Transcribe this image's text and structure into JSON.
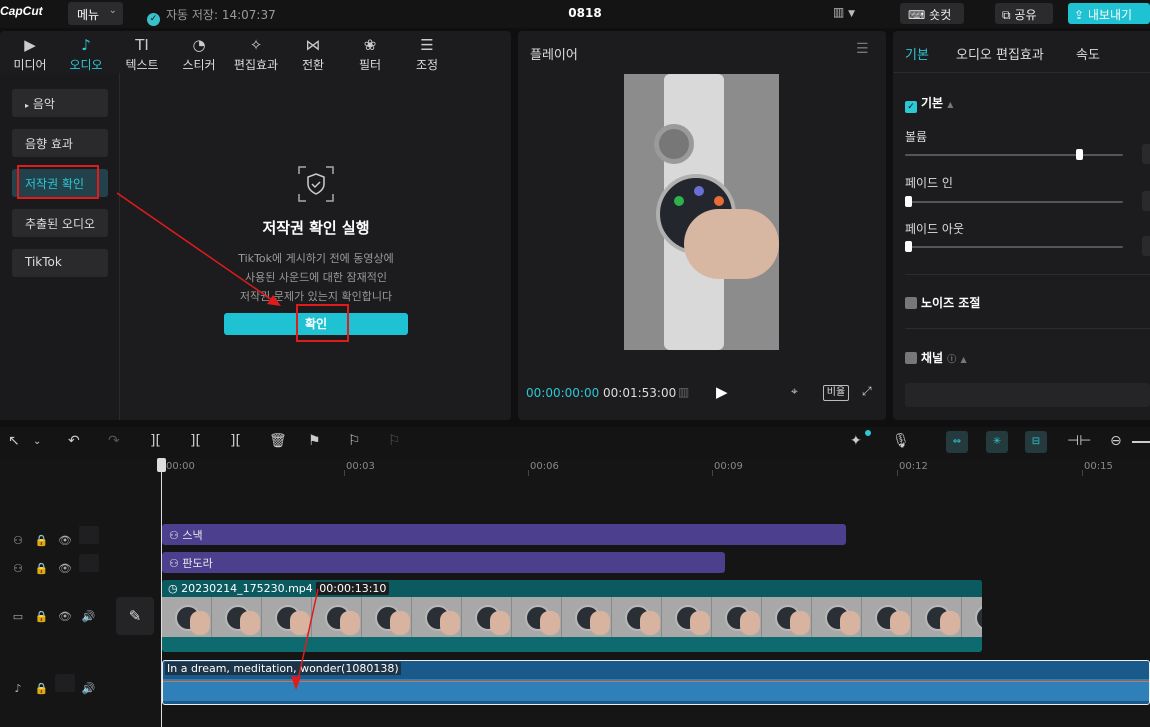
{
  "topbar": {
    "logo": "CapCut",
    "menu_label": "메뉴",
    "autosave": "자동 저장: 14:07:37",
    "project_name": "0818",
    "shortcut_label": "숏컷",
    "share_label": "공유",
    "export_label": "내보내기"
  },
  "left_panel": {
    "tabs": [
      {
        "label": "미디어",
        "icon": "media-icon"
      },
      {
        "label": "오디오",
        "icon": "audio-icon"
      },
      {
        "label": "텍스트",
        "icon": "text-icon"
      },
      {
        "label": "스티커",
        "icon": "sticker-icon"
      },
      {
        "label": "편집효과",
        "icon": "effects-icon"
      },
      {
        "label": "전환",
        "icon": "transition-icon"
      },
      {
        "label": "필터",
        "icon": "filter-icon"
      },
      {
        "label": "조정",
        "icon": "adjust-icon"
      }
    ],
    "active_tab": "오디오",
    "subnav": [
      "음악",
      "음향 효과",
      "저작권 확인",
      "추출된 오디오",
      "TikTok"
    ],
    "selected_subnav": "저작권 확인",
    "content": {
      "title": "저작권 확인 실행",
      "desc_1": "TikTok에 게시하기 전에 동영상에",
      "desc_2": "사용된 사운드에 대한 잠재적인",
      "desc_3": "저작권 문제가 있는지 확인합니다",
      "confirm_label": "확인"
    }
  },
  "player": {
    "title": "플레이어",
    "current_time": "00:00:00:00",
    "duration": "00:01:53:00",
    "ratio_label": "비율"
  },
  "inspector": {
    "tabs": [
      "기본",
      "오디오 편집효과",
      "속도"
    ],
    "active_tab": "기본",
    "basic_label": "기본",
    "volume_label": "볼륨",
    "volume_level": 0.8,
    "fade_in_label": "페이드 인",
    "fade_out_label": "페이드 아웃",
    "noise_label": "노이즈 조절",
    "channel_label": "채널"
  },
  "timeline": {
    "ruler": [
      "00:00",
      "00:03",
      "00:06",
      "00:09",
      "00:12",
      "00:15"
    ],
    "text_clips": [
      "스낵",
      "판도라"
    ],
    "video_clip": {
      "name": "20230214_175230.mp4",
      "duration": "00:00:13:10"
    },
    "audio_clip": {
      "name": "In a dream, meditation, wonder(1080138)"
    }
  },
  "colors": {
    "accent": "#1fc2d2",
    "annotation": "#e01b1b",
    "text_clip": "#4b3f8e",
    "video_clip": "#0d6b70",
    "audio_clip": "#1a5a8a"
  }
}
